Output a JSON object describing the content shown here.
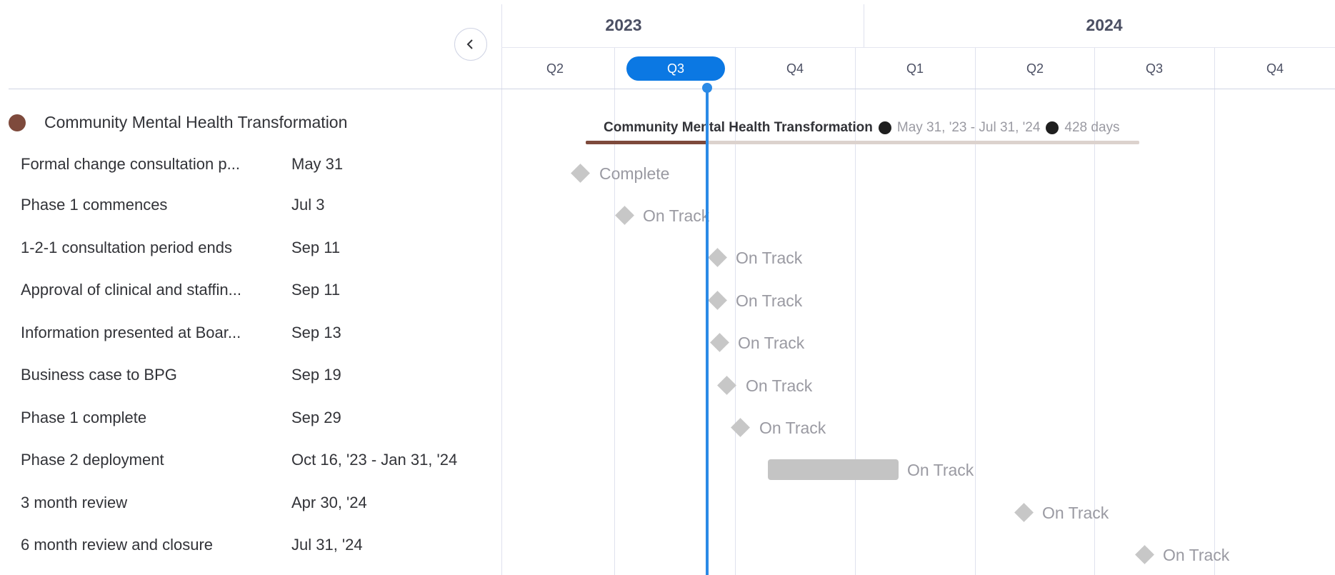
{
  "timeline": {
    "years": [
      "2023",
      "2024"
    ],
    "quarters": [
      "Q2",
      "Q3",
      "Q4",
      "Q1",
      "Q2",
      "Q3",
      "Q4"
    ],
    "active_quarter": "Q3"
  },
  "group": {
    "title": "Community Mental Health Transformation",
    "color": "#7e4a3c",
    "summary": {
      "name": "Community Mental Health Transformation",
      "range": "May 31, '23 - Jul 31, '24",
      "duration": "428 days"
    }
  },
  "items": [
    {
      "name": "Formal change consultation p...",
      "date": "May 31",
      "status": "Complete"
    },
    {
      "name": "Phase 1 commences",
      "date": "Jul 3",
      "status": "On Track"
    },
    {
      "name": "1-2-1 consultation period ends",
      "date": "Sep 11",
      "status": "On Track"
    },
    {
      "name": "Approval of clinical and staffin...",
      "date": "Sep 11",
      "status": "On Track"
    },
    {
      "name": "Information presented at Boar...",
      "date": "Sep 13",
      "status": "On Track"
    },
    {
      "name": "Business case to BPG",
      "date": "Sep 19",
      "status": "On Track"
    },
    {
      "name": "Phase 1 complete",
      "date": "Sep 29",
      "status": "On Track"
    },
    {
      "name": "Phase 2 deployment",
      "date": "Oct 16, '23 - Jan 31, '24",
      "status": "On Track"
    },
    {
      "name": "3 month review",
      "date": "Apr 30, '24",
      "status": "On Track"
    },
    {
      "name": "6 month review and closure",
      "date": "Jul 31, '24",
      "status": "On Track"
    }
  ],
  "colors": {
    "accent": "#0b78e3",
    "today_line": "#2b8ae6",
    "milestone": "#c7c7c7"
  },
  "icons": {
    "collapse": "chevron-left-icon",
    "milestone": "diamond-icon"
  }
}
